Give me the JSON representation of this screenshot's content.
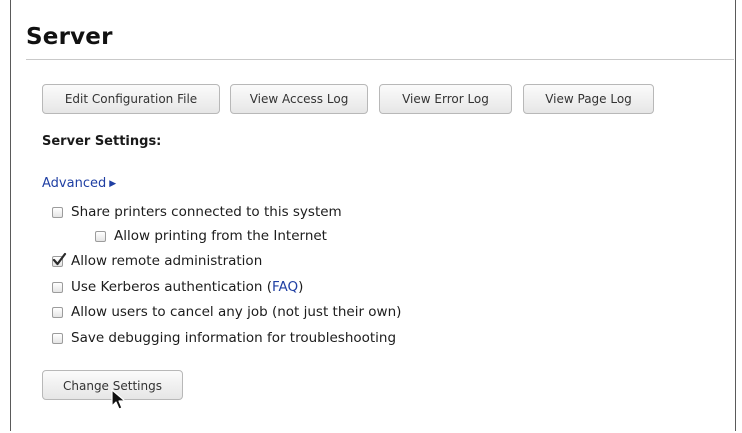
{
  "page": {
    "title": "Server"
  },
  "toolbar": {
    "buttons": [
      {
        "label": "Edit Configuration File"
      },
      {
        "label": "View Access Log"
      },
      {
        "label": "View Error Log"
      },
      {
        "label": "View Page Log"
      }
    ]
  },
  "settings": {
    "heading": "Server Settings:",
    "advanced_label": "Advanced",
    "options": {
      "share_printers": {
        "label": "Share printers connected to this system",
        "checked": false
      },
      "allow_internet": {
        "label": "Allow printing from the Internet",
        "checked": false
      },
      "remote_admin": {
        "label": "Allow remote administration",
        "checked": true
      },
      "kerberos": {
        "label": "Use Kerberos authentication",
        "link": "FAQ",
        "open_paren": "(",
        "close_paren": ")",
        "checked": false
      },
      "cancel_jobs": {
        "label": "Allow users to cancel any job (not just their own)",
        "checked": false
      },
      "debug_info": {
        "label": "Save debugging information for troubleshooting",
        "checked": false
      }
    },
    "submit_label": "Change Settings"
  },
  "colors": {
    "link": "#1f3fa3",
    "button_border": "#b8b8b8",
    "rule": "#c9c9c9"
  },
  "icons": {
    "advanced_arrow": "triangle-right-icon",
    "checkmark": "checkmark-icon",
    "cursor": "mouse-pointer-icon"
  }
}
